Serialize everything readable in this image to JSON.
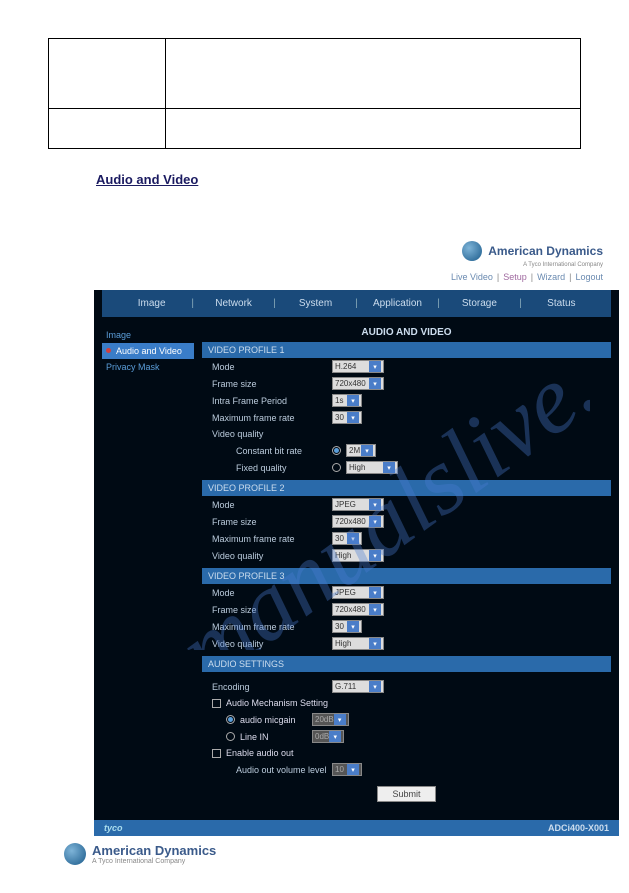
{
  "brand": {
    "name": "American Dynamics",
    "tagline": "A Tyco International Company"
  },
  "toolbar": {
    "live": "Live Video",
    "setup": "Setup",
    "wizard": "Wizard",
    "logout": "Logout"
  },
  "nav": {
    "image": "Image",
    "network": "Network",
    "system": "System",
    "application": "Application",
    "storage": "Storage",
    "status": "Status"
  },
  "sidebar": {
    "image": "Image",
    "av": "Audio and Video",
    "privacy": "Privacy Mask"
  },
  "headings": {
    "page": "AUDIO AND VIDEO",
    "vp1": "VIDEO PROFILE 1",
    "vp2": "VIDEO PROFILE 2",
    "vp3": "VIDEO PROFILE 3",
    "audio": "AUDIO SETTINGS"
  },
  "labels": {
    "mode": "Mode",
    "frame_size": "Frame size",
    "intra": "Intra Frame Period",
    "max_fr": "Maximum frame rate",
    "vq": "Video quality",
    "cbr": "Constant bit rate",
    "fq": "Fixed quality",
    "encoding": "Encoding",
    "ams": "Audio Mechanism Setting",
    "micgain": "audio micgain",
    "linein": "Line IN",
    "enable_ao": "Enable audio out",
    "ao_level": "Audio out volume level"
  },
  "values": {
    "vp1": {
      "mode": "H.264",
      "frame_size": "720x480",
      "intra": "1s",
      "max_fr": "30",
      "cbr": "2M",
      "fq": "High"
    },
    "vp2": {
      "mode": "JPEG",
      "frame_size": "720x480",
      "max_fr": "30",
      "vq": "High"
    },
    "vp3": {
      "mode": "JPEG",
      "frame_size": "720x480",
      "max_fr": "30",
      "vq": "High"
    },
    "audio": {
      "encoding": "G.711",
      "micgain": "20dB",
      "linein": "0dB",
      "ao_level": "10"
    }
  },
  "buttons": {
    "submit": "Submit"
  },
  "footer": {
    "brand": "tyco",
    "model": "ADCi400-X001"
  },
  "section_underline": "Audio and Video"
}
